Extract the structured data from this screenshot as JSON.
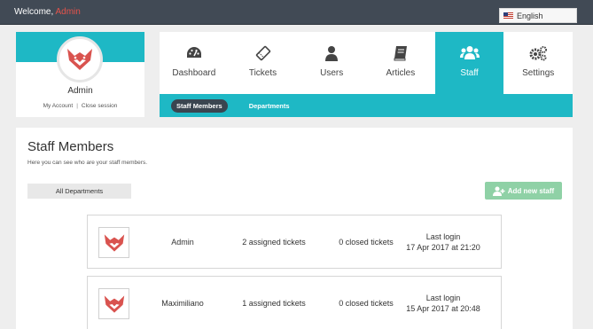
{
  "topbar": {
    "welcome_prefix": "Welcome, ",
    "welcome_user": "Admin",
    "language": "English"
  },
  "profile": {
    "name": "Admin",
    "my_account": "My Account",
    "separator": "|",
    "close_session": "Close session"
  },
  "nav": {
    "items": [
      {
        "label": "Dashboard",
        "icon": "dashboard-icon"
      },
      {
        "label": "Tickets",
        "icon": "ticket-icon"
      },
      {
        "label": "Users",
        "icon": "user-icon"
      },
      {
        "label": "Articles",
        "icon": "book-icon"
      },
      {
        "label": "Staff",
        "icon": "staff-icon"
      },
      {
        "label": "Settings",
        "icon": "gears-icon"
      }
    ],
    "active": "Staff",
    "subtabs": [
      {
        "label": "Staff Members"
      },
      {
        "label": "Departments"
      }
    ]
  },
  "main": {
    "title": "Staff Members",
    "description": "Here you can see who are your staff members.",
    "department_filter": "All Departments",
    "add_button": "Add new staff"
  },
  "staff": [
    {
      "name": "Admin",
      "assigned": "2 assigned tickets",
      "closed": "0 closed tickets",
      "login_label": "Last login",
      "login_date": "17 Apr 2017 at 21:20"
    },
    {
      "name": "Maximiliano",
      "assigned": "1 assigned tickets",
      "closed": "0 closed tickets",
      "login_label": "Last login",
      "login_date": "15 Apr 2017 at 20:48"
    }
  ],
  "colors": {
    "accent": "#1eb8c5",
    "topbar": "#414a55",
    "add_button": "#8fd1a6",
    "welcome_user": "#e5534b"
  }
}
